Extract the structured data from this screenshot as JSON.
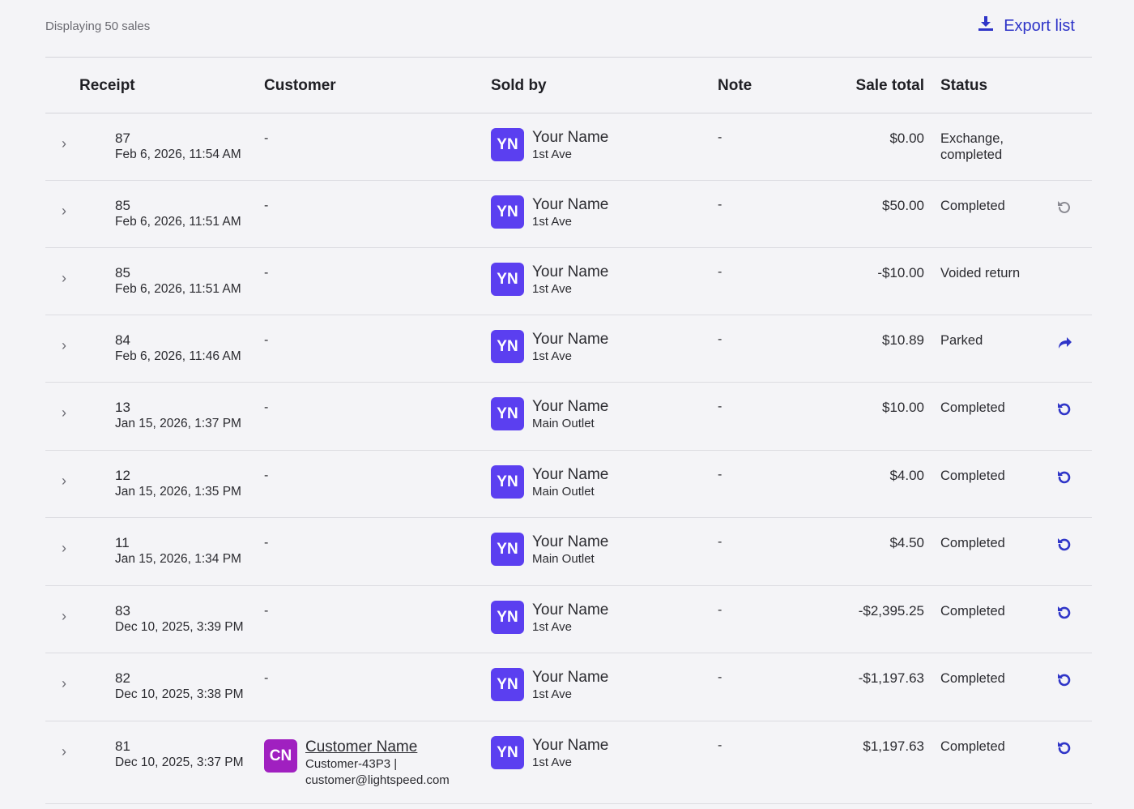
{
  "header": {
    "count_text": "Displaying 50 sales",
    "export_label": "Export list",
    "export_icon": "download-icon"
  },
  "columns": {
    "receipt": "Receipt",
    "customer": "Customer",
    "sold_by": "Sold by",
    "note": "Note",
    "sale_total": "Sale total",
    "status": "Status"
  },
  "colors": {
    "accent": "#2f35c8",
    "seller_avatar": "#5b3ff0",
    "customer_avatar": "#a020c0",
    "action_disabled": "#8a8a92"
  },
  "rows": [
    {
      "receipt": "87",
      "date": "Feb 6, 2026, 11:54 AM",
      "customer": "-",
      "seller_initials": "YN",
      "seller": "Your Name",
      "outlet": "1st Ave",
      "note": "-",
      "total": "$0.00",
      "status": "Exchange,",
      "status2": "completed",
      "action": "none"
    },
    {
      "receipt": "85",
      "date": "Feb 6, 2026, 11:51 AM",
      "customer": "-",
      "seller_initials": "YN",
      "seller": "Your Name",
      "outlet": "1st Ave",
      "note": "-",
      "total": "$50.00",
      "status": "Completed",
      "status2": "",
      "action": "return-disabled"
    },
    {
      "receipt": "85",
      "date": "Feb 6, 2026, 11:51 AM",
      "customer": "-",
      "seller_initials": "YN",
      "seller": "Your Name",
      "outlet": "1st Ave",
      "note": "-",
      "total": "-$10.00",
      "status": "Voided return",
      "status2": "",
      "action": "none"
    },
    {
      "receipt": "84",
      "date": "Feb 6, 2026, 11:46 AM",
      "customer": "-",
      "seller_initials": "YN",
      "seller": "Your Name",
      "outlet": "1st Ave",
      "note": "-",
      "total": "$10.89",
      "status": "Parked",
      "status2": "",
      "action": "continue"
    },
    {
      "receipt": "13",
      "date": "Jan 15, 2026, 1:37 PM",
      "customer": "-",
      "seller_initials": "YN",
      "seller": "Your Name",
      "outlet": "Main Outlet",
      "note": "-",
      "total": "$10.00",
      "status": "Completed",
      "status2": "",
      "action": "return"
    },
    {
      "receipt": "12",
      "date": "Jan 15, 2026, 1:35 PM",
      "customer": "-",
      "seller_initials": "YN",
      "seller": "Your Name",
      "outlet": "Main Outlet",
      "note": "-",
      "total": "$4.00",
      "status": "Completed",
      "status2": "",
      "action": "return"
    },
    {
      "receipt": "11",
      "date": "Jan 15, 2026, 1:34 PM",
      "customer": "-",
      "seller_initials": "YN",
      "seller": "Your Name",
      "outlet": "Main Outlet",
      "note": "-",
      "total": "$4.50",
      "status": "Completed",
      "status2": "",
      "action": "return"
    },
    {
      "receipt": "83",
      "date": "Dec 10, 2025, 3:39 PM",
      "customer": "-",
      "seller_initials": "YN",
      "seller": "Your Name",
      "outlet": "1st Ave",
      "note": "-",
      "total": "-$2,395.25",
      "status": "Completed",
      "status2": "",
      "action": "return"
    },
    {
      "receipt": "82",
      "date": "Dec 10, 2025, 3:38 PM",
      "customer": "-",
      "seller_initials": "YN",
      "seller": "Your Name",
      "outlet": "1st Ave",
      "note": "-",
      "total": "-$1,197.63",
      "status": "Completed",
      "status2": "",
      "action": "return"
    },
    {
      "receipt": "81",
      "date": "Dec 10, 2025, 3:37 PM",
      "customer": "",
      "customer_initials": "CN",
      "customer_name": "Customer Name",
      "customer_line2": "Customer-43P3 |",
      "customer_line3": "customer@lightspeed.com",
      "seller_initials": "YN",
      "seller": "Your Name",
      "outlet": "1st Ave",
      "note": "-",
      "total": "$1,197.63",
      "status": "Completed",
      "status2": "",
      "action": "return"
    }
  ]
}
